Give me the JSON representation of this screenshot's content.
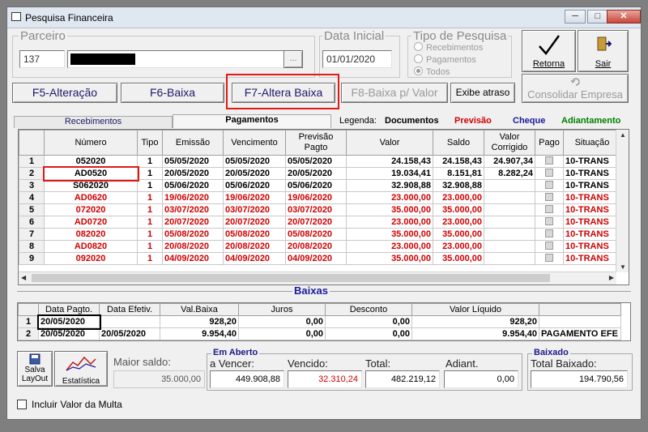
{
  "window": {
    "title": "Pesquisa Financeira",
    "min": "─",
    "max": "□",
    "close": "✕"
  },
  "parceiro": {
    "label": "Parceiro",
    "code": "137",
    "lookup": "..."
  },
  "data_inicial": {
    "label": "Data Inicial",
    "value": "01/01/2020"
  },
  "tipo_pesquisa": {
    "label": "Tipo de Pesquisa",
    "options": [
      "Recebimentos",
      "Pagamentos",
      "Todos"
    ],
    "selected": "Todos"
  },
  "toolbar": {
    "retorna": "Retorna",
    "sair": "Sair",
    "f5": "F5-Alteração",
    "f6": "F6-Baixa",
    "f7": "F7-Altera Baixa",
    "f8": "F8-Baixa p/ Valor",
    "atraso": "Exibe atraso",
    "consolidar": "Consolidar Empresa"
  },
  "tabs": [
    "Recebimentos",
    "Pagamentos"
  ],
  "active_tab": "Pagamentos",
  "legend": {
    "label": "Legenda:",
    "items": [
      {
        "text": "Documentos",
        "color": "#000000"
      },
      {
        "text": "Previsão",
        "color": "#d00000"
      },
      {
        "text": "Cheque",
        "color": "#1a1a9a"
      },
      {
        "text": "Adiantamento",
        "color": "#008000"
      }
    ]
  },
  "grid": {
    "columns": [
      "Número",
      "Tipo",
      "Emissão",
      "Vencimento",
      "Previsão Pagto",
      "Valor",
      "Saldo",
      "Valor Corrigido",
      "Pago",
      "Situação"
    ],
    "rows": [
      {
        "n": "1",
        "numero": "052020",
        "tipo": "1",
        "emissao": "05/05/2020",
        "venc": "05/05/2020",
        "prev": "05/05/2020",
        "valor": "24.158,43",
        "saldo": "24.158,43",
        "corr": "24.907,34",
        "sit": "10-TRANS",
        "red": false
      },
      {
        "n": "2",
        "numero": "AD0520",
        "tipo": "1",
        "emissao": "20/05/2020",
        "venc": "20/05/2020",
        "prev": "20/05/2020",
        "valor": "19.034,41",
        "saldo": "8.151,81",
        "corr": "8.282,24",
        "sit": "10-TRANS",
        "red": false
      },
      {
        "n": "3",
        "numero": "S062020",
        "tipo": "1",
        "emissao": "05/06/2020",
        "venc": "05/06/2020",
        "prev": "05/06/2020",
        "valor": "32.908,88",
        "saldo": "32.908,88",
        "corr": "",
        "sit": "10-TRANS",
        "red": false
      },
      {
        "n": "4",
        "numero": "AD0620",
        "tipo": "1",
        "emissao": "19/06/2020",
        "venc": "19/06/2020",
        "prev": "19/06/2020",
        "valor": "23.000,00",
        "saldo": "23.000,00",
        "corr": "",
        "sit": "10-TRANS",
        "red": true
      },
      {
        "n": "5",
        "numero": "072020",
        "tipo": "1",
        "emissao": "03/07/2020",
        "venc": "03/07/2020",
        "prev": "03/07/2020",
        "valor": "35.000,00",
        "saldo": "35.000,00",
        "corr": "",
        "sit": "10-TRANS",
        "red": true
      },
      {
        "n": "6",
        "numero": "AD0720",
        "tipo": "1",
        "emissao": "20/07/2020",
        "venc": "20/07/2020",
        "prev": "20/07/2020",
        "valor": "23.000,00",
        "saldo": "23.000,00",
        "corr": "",
        "sit": "10-TRANS",
        "red": true
      },
      {
        "n": "7",
        "numero": "082020",
        "tipo": "1",
        "emissao": "05/08/2020",
        "venc": "05/08/2020",
        "prev": "05/08/2020",
        "valor": "35.000,00",
        "saldo": "35.000,00",
        "corr": "",
        "sit": "10-TRANS",
        "red": true
      },
      {
        "n": "8",
        "numero": "AD0820",
        "tipo": "1",
        "emissao": "20/08/2020",
        "venc": "20/08/2020",
        "prev": "20/08/2020",
        "valor": "23.000,00",
        "saldo": "23.000,00",
        "corr": "",
        "sit": "10-TRANS",
        "red": true
      },
      {
        "n": "9",
        "numero": "092020",
        "tipo": "1",
        "emissao": "04/09/2020",
        "venc": "04/09/2020",
        "prev": "04/09/2020",
        "valor": "35.000,00",
        "saldo": "35.000,00",
        "corr": "",
        "sit": "10-TRANS",
        "red": true
      }
    ]
  },
  "baixas": {
    "title": "Baixas",
    "columns": [
      "Data Pagto.",
      "Data Efetiv.",
      "Val.Baixa",
      "Juros",
      "Desconto",
      "Valor Líquido"
    ],
    "rows": [
      {
        "n": "1",
        "pagto": "20/05/2020",
        "efetiv": "",
        "val": "928,20",
        "juros": "0,00",
        "desc": "0,00",
        "liq": "928,20",
        "obs": ""
      },
      {
        "n": "2",
        "pagto": "20/05/2020",
        "efetiv": "20/05/2020",
        "val": "9.954,40",
        "juros": "0,00",
        "desc": "0,00",
        "liq": "9.954,40",
        "obs": "PAGAMENTO EFE"
      }
    ]
  },
  "bottom": {
    "salva_layout": "Salva LayOut",
    "estatistica": "Estatística",
    "maior_saldo_label": "Maior saldo:",
    "maior_saldo": "35.000,00",
    "em_aberto": "Em Aberto",
    "a_vencer_label": "a Vencer:",
    "a_vencer": "449.908,88",
    "vencido_label": "Vencido:",
    "vencido": "32.310,24",
    "total_label": "Total:",
    "total": "482.219,12",
    "adiant_label": "Adiant.",
    "adiant": "0,00",
    "baixado": "Baixado",
    "total_baixado_label": "Total Baixado:",
    "total_baixado": "194.790,56",
    "multa": "Incluir Valor da Multa"
  }
}
